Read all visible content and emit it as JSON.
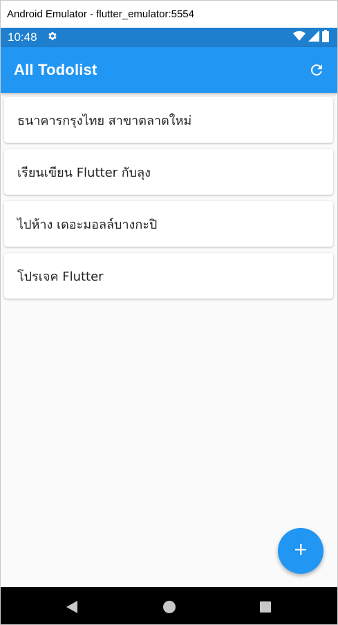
{
  "window": {
    "title": "Android Emulator - flutter_emulator:5554"
  },
  "status_bar": {
    "time": "10:48",
    "background": "#1e7fcf"
  },
  "app_bar": {
    "title": "All Todolist",
    "background": "#2196f3"
  },
  "todos": [
    {
      "title": "ธนาคารกรุงไทย สาขาตลาดใหม่"
    },
    {
      "title": "เรียนเขียน Flutter กับลุง"
    },
    {
      "title": "ไปห้าง เดอะมอลล์บางกะปิ"
    },
    {
      "title": "โปรเจค Flutter"
    }
  ],
  "icons": {
    "settings": "gear-icon",
    "wifi": "wifi-icon",
    "signal": "signal-icon",
    "battery": "battery-icon",
    "refresh": "refresh-icon",
    "add": "plus-icon",
    "back": "back-triangle-icon",
    "home": "home-circle-icon",
    "recents": "recents-square-icon"
  }
}
